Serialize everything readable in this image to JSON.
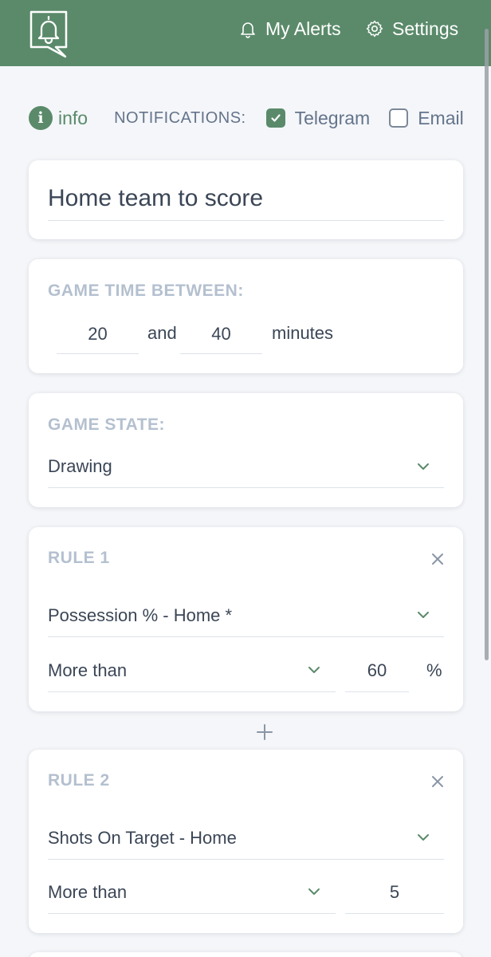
{
  "header": {
    "logo_icon": "bell-chat-logo-icon",
    "my_alerts": "My Alerts",
    "settings": "Settings",
    "bg_color": "#5a8a6a"
  },
  "toolbar": {
    "info_label": "info",
    "notifications_label": "NOTIFICATIONS:",
    "telegram_label": "Telegram",
    "telegram_checked": true,
    "email_label": "Email",
    "email_checked": false
  },
  "alert_name": {
    "value": "Home team to score"
  },
  "game_time": {
    "label": "GAME TIME BETWEEN:",
    "from": "20",
    "and_label": "and",
    "to": "40",
    "unit": "minutes"
  },
  "game_state": {
    "label": "GAME STATE:",
    "value": "Drawing"
  },
  "rules": [
    {
      "label": "RULE 1",
      "stat": "Possession % - Home *",
      "comparator": "More than",
      "value": "60",
      "unit": "%"
    },
    {
      "label": "RULE 2",
      "stat": "Shots On Target - Home",
      "comparator": "More than",
      "value": "5"
    }
  ]
}
